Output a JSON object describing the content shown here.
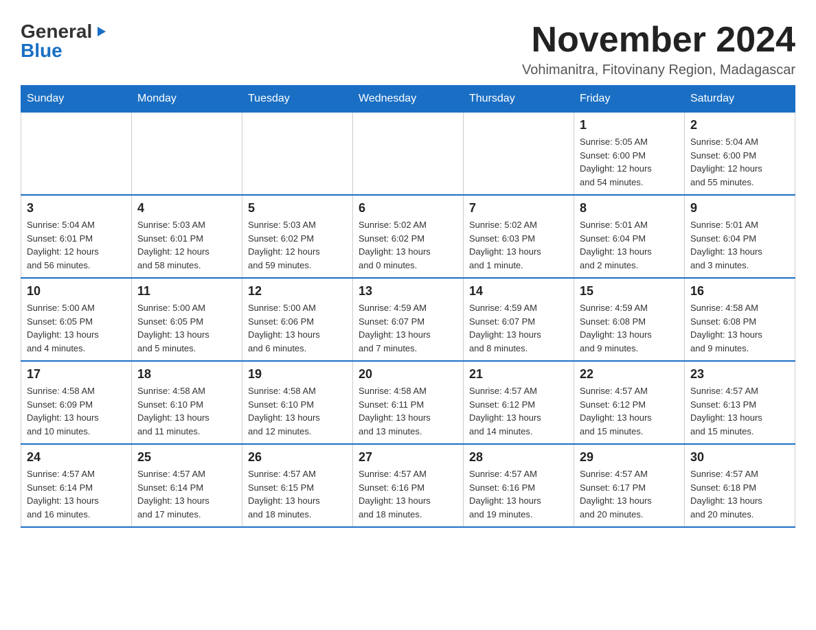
{
  "header": {
    "logo": {
      "general": "General",
      "arrow": "▶",
      "blue": "Blue"
    },
    "title": "November 2024",
    "subtitle": "Vohimanitra, Fitovinany Region, Madagascar"
  },
  "weekdays": [
    "Sunday",
    "Monday",
    "Tuesday",
    "Wednesday",
    "Thursday",
    "Friday",
    "Saturday"
  ],
  "weeks": [
    [
      {
        "day": "",
        "info": ""
      },
      {
        "day": "",
        "info": ""
      },
      {
        "day": "",
        "info": ""
      },
      {
        "day": "",
        "info": ""
      },
      {
        "day": "",
        "info": ""
      },
      {
        "day": "1",
        "info": "Sunrise: 5:05 AM\nSunset: 6:00 PM\nDaylight: 12 hours\nand 54 minutes."
      },
      {
        "day": "2",
        "info": "Sunrise: 5:04 AM\nSunset: 6:00 PM\nDaylight: 12 hours\nand 55 minutes."
      }
    ],
    [
      {
        "day": "3",
        "info": "Sunrise: 5:04 AM\nSunset: 6:01 PM\nDaylight: 12 hours\nand 56 minutes."
      },
      {
        "day": "4",
        "info": "Sunrise: 5:03 AM\nSunset: 6:01 PM\nDaylight: 12 hours\nand 58 minutes."
      },
      {
        "day": "5",
        "info": "Sunrise: 5:03 AM\nSunset: 6:02 PM\nDaylight: 12 hours\nand 59 minutes."
      },
      {
        "day": "6",
        "info": "Sunrise: 5:02 AM\nSunset: 6:02 PM\nDaylight: 13 hours\nand 0 minutes."
      },
      {
        "day": "7",
        "info": "Sunrise: 5:02 AM\nSunset: 6:03 PM\nDaylight: 13 hours\nand 1 minute."
      },
      {
        "day": "8",
        "info": "Sunrise: 5:01 AM\nSunset: 6:04 PM\nDaylight: 13 hours\nand 2 minutes."
      },
      {
        "day": "9",
        "info": "Sunrise: 5:01 AM\nSunset: 6:04 PM\nDaylight: 13 hours\nand 3 minutes."
      }
    ],
    [
      {
        "day": "10",
        "info": "Sunrise: 5:00 AM\nSunset: 6:05 PM\nDaylight: 13 hours\nand 4 minutes."
      },
      {
        "day": "11",
        "info": "Sunrise: 5:00 AM\nSunset: 6:05 PM\nDaylight: 13 hours\nand 5 minutes."
      },
      {
        "day": "12",
        "info": "Sunrise: 5:00 AM\nSunset: 6:06 PM\nDaylight: 13 hours\nand 6 minutes."
      },
      {
        "day": "13",
        "info": "Sunrise: 4:59 AM\nSunset: 6:07 PM\nDaylight: 13 hours\nand 7 minutes."
      },
      {
        "day": "14",
        "info": "Sunrise: 4:59 AM\nSunset: 6:07 PM\nDaylight: 13 hours\nand 8 minutes."
      },
      {
        "day": "15",
        "info": "Sunrise: 4:59 AM\nSunset: 6:08 PM\nDaylight: 13 hours\nand 9 minutes."
      },
      {
        "day": "16",
        "info": "Sunrise: 4:58 AM\nSunset: 6:08 PM\nDaylight: 13 hours\nand 9 minutes."
      }
    ],
    [
      {
        "day": "17",
        "info": "Sunrise: 4:58 AM\nSunset: 6:09 PM\nDaylight: 13 hours\nand 10 minutes."
      },
      {
        "day": "18",
        "info": "Sunrise: 4:58 AM\nSunset: 6:10 PM\nDaylight: 13 hours\nand 11 minutes."
      },
      {
        "day": "19",
        "info": "Sunrise: 4:58 AM\nSunset: 6:10 PM\nDaylight: 13 hours\nand 12 minutes."
      },
      {
        "day": "20",
        "info": "Sunrise: 4:58 AM\nSunset: 6:11 PM\nDaylight: 13 hours\nand 13 minutes."
      },
      {
        "day": "21",
        "info": "Sunrise: 4:57 AM\nSunset: 6:12 PM\nDaylight: 13 hours\nand 14 minutes."
      },
      {
        "day": "22",
        "info": "Sunrise: 4:57 AM\nSunset: 6:12 PM\nDaylight: 13 hours\nand 15 minutes."
      },
      {
        "day": "23",
        "info": "Sunrise: 4:57 AM\nSunset: 6:13 PM\nDaylight: 13 hours\nand 15 minutes."
      }
    ],
    [
      {
        "day": "24",
        "info": "Sunrise: 4:57 AM\nSunset: 6:14 PM\nDaylight: 13 hours\nand 16 minutes."
      },
      {
        "day": "25",
        "info": "Sunrise: 4:57 AM\nSunset: 6:14 PM\nDaylight: 13 hours\nand 17 minutes."
      },
      {
        "day": "26",
        "info": "Sunrise: 4:57 AM\nSunset: 6:15 PM\nDaylight: 13 hours\nand 18 minutes."
      },
      {
        "day": "27",
        "info": "Sunrise: 4:57 AM\nSunset: 6:16 PM\nDaylight: 13 hours\nand 18 minutes."
      },
      {
        "day": "28",
        "info": "Sunrise: 4:57 AM\nSunset: 6:16 PM\nDaylight: 13 hours\nand 19 minutes."
      },
      {
        "day": "29",
        "info": "Sunrise: 4:57 AM\nSunset: 6:17 PM\nDaylight: 13 hours\nand 20 minutes."
      },
      {
        "day": "30",
        "info": "Sunrise: 4:57 AM\nSunset: 6:18 PM\nDaylight: 13 hours\nand 20 minutes."
      }
    ]
  ]
}
